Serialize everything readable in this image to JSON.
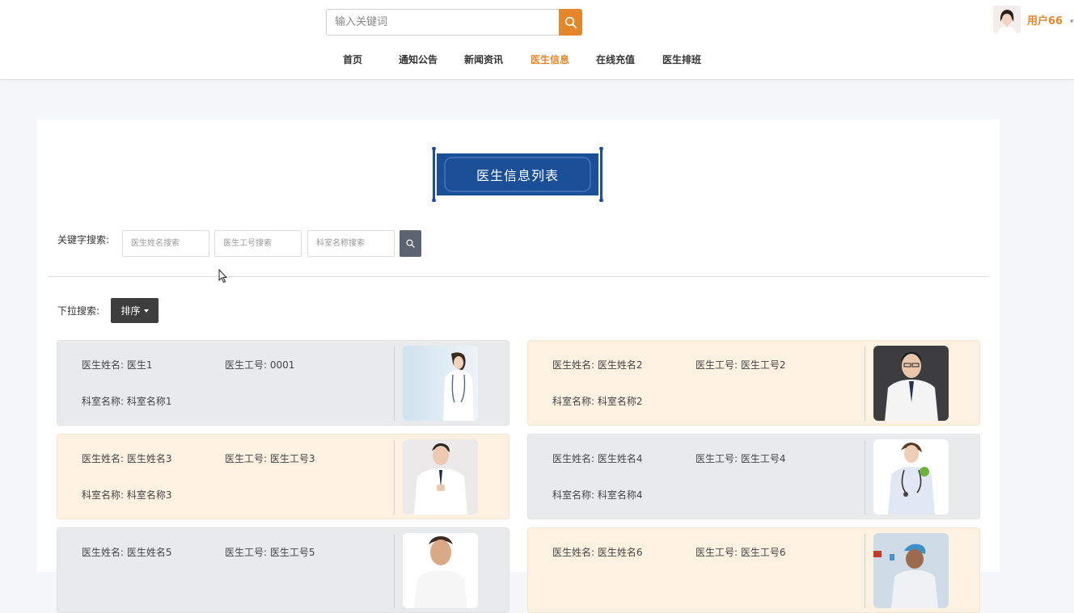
{
  "header": {
    "search": {
      "placeholder": "输入关键词",
      "value": ""
    },
    "user": {
      "name": "用户66"
    },
    "nav": [
      {
        "label": "首页",
        "active": false
      },
      {
        "label": "通知公告",
        "active": false
      },
      {
        "label": "新闻资讯",
        "active": false
      },
      {
        "label": "医生信息",
        "active": true
      },
      {
        "label": "在线充值",
        "active": false
      },
      {
        "label": "医生排班",
        "active": false
      }
    ]
  },
  "page": {
    "title": "医生信息列表",
    "keyword_label": "关键字搜索:",
    "keyword_inputs": [
      {
        "placeholder": "医生姓名搜索",
        "value": ""
      },
      {
        "placeholder": "医生工号搜索",
        "value": ""
      },
      {
        "placeholder": "科室名称搜索",
        "value": ""
      }
    ],
    "dropdown_label": "下拉搜索:",
    "sort_label": "排序"
  },
  "colors": {
    "accent": "#e5862b",
    "banner": "#1b4f97",
    "card_gray": "#e9eaeb",
    "card_peach": "#fdf1e1"
  },
  "doctors": [
    {
      "name": "医生姓名: 医生1",
      "number": "医生工号: 0001",
      "dept": "科室名称: 科室名称1"
    },
    {
      "name": "医生姓名: 医生姓名2",
      "number": "医生工号: 医生工号2",
      "dept": "科室名称: 科室名称2"
    },
    {
      "name": "医生姓名: 医生姓名3",
      "number": "医生工号: 医生工号3",
      "dept": "科室名称: 科室名称3"
    },
    {
      "name": "医生姓名: 医生姓名4",
      "number": "医生工号: 医生工号4",
      "dept": "科室名称: 科室名称4"
    },
    {
      "name": "医生姓名: 医生姓名5",
      "number": "医生工号: 医生工号5",
      "dept": ""
    },
    {
      "name": "医生姓名: 医生姓名6",
      "number": "医生工号: 医生工号6",
      "dept": ""
    }
  ]
}
